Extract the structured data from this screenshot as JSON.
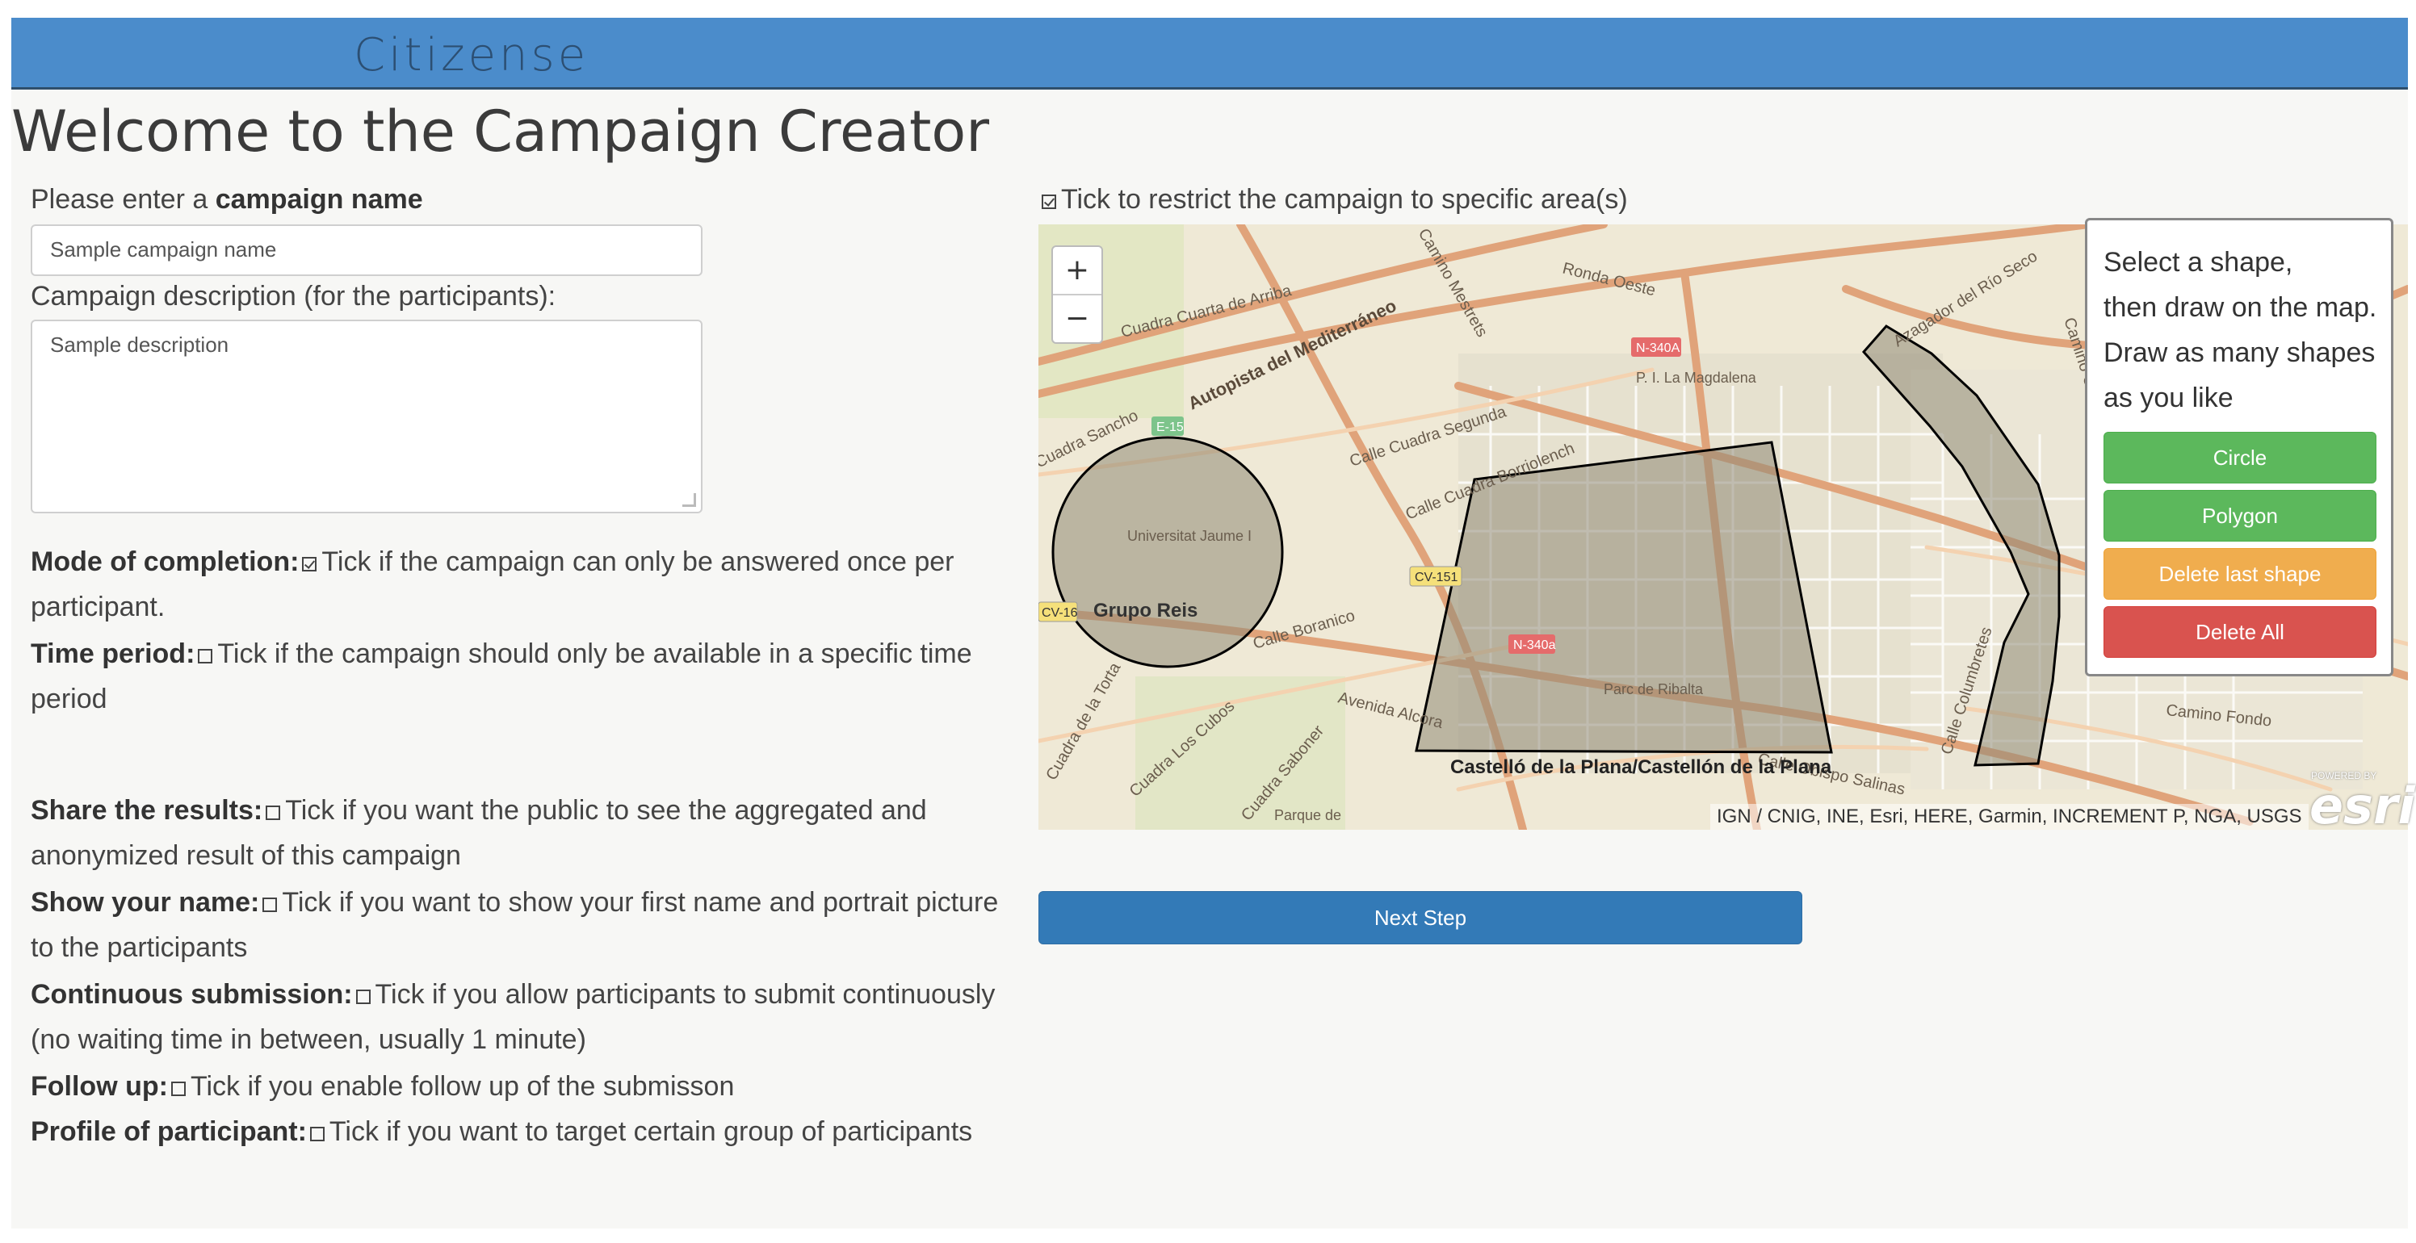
{
  "app": {
    "brand": "Citizense",
    "page_title": "Welcome to the Campaign Creator"
  },
  "form": {
    "name_prefix": "Please enter a ",
    "name_bold": "campaign name",
    "name_value": "Sample campaign name",
    "description_label": "Campaign description (for the participants):",
    "description_value": "Sample description"
  },
  "options": [
    {
      "label": "Mode of completion:",
      "checked": true,
      "text": "Tick if the campaign can only be answered once per participant."
    },
    {
      "label": "Time period:",
      "checked": false,
      "text": "Tick if the campaign should only be available in a specific time period"
    },
    {
      "label": "Share the results:",
      "checked": false,
      "text": "Tick if you want the public to see the aggregated and anonymized result of this campaign"
    },
    {
      "label": "Show your name:",
      "checked": false,
      "text": "Tick if you want to show your first name and portrait picture to the participants"
    },
    {
      "label": "Continuous submission:",
      "checked": false,
      "text": "Tick if you allow participants to submit continuously (no waiting time in between, usually 1 minute)"
    },
    {
      "label": "Follow up:",
      "checked": false,
      "text": "Tick if you enable follow up of the submisson"
    },
    {
      "label": "Profile of participant:",
      "checked": false,
      "text": "Tick if you want to target certain group of participants"
    }
  ],
  "map": {
    "restrict_text": "Tick to restrict the campaign to specific area(s)",
    "restrict_checked": true,
    "zoom_in": "+",
    "zoom_out": "−",
    "attribution": "IGN / CNIG, INE, Esri, HERE, Garmin, INCREMENT P, NGA, USGS",
    "esri_powered": "POWERED BY",
    "esri_logo": "esri",
    "labels": {
      "ronda_oeste": "Ronda Oeste",
      "cuadra_cuarta": "Cuadra Cuarta de Arriba",
      "autopista": "Autopista del Mediterráneo",
      "calle_cuadra_segunda": "Calle Cuadra Segunda",
      "calle_cuadra_borriolench": "Calle Cuadra Borriolench",
      "universitat": "Universitat Jaume I",
      "grupo_reis": "Grupo Reis",
      "calle_boranico": "Calle Boranico",
      "avenida_alcora": "Avenida Alcora",
      "castello": "Castelló de la Plana/Castellón de la Plana",
      "calle_obispo": "Calle Obispo Salinas",
      "camino_fondo": "Camino Fondo",
      "calle_columbretes": "Calle Columbretes",
      "azagador": "Azagador del Río Seco",
      "camino_caminas": "Camino Caminas",
      "pi_magdalena": "P. I. La Magdalena",
      "parc_ribalta": "Parc de Ribalta",
      "cuadra_sancho": "Cuadra Sancho",
      "cuadra_torta": "Cuadra de la Torta",
      "cuadra_cubos": "Cuadra Los Cubos",
      "cuadra_saboner": "Cuadra Saboner",
      "parque": "Parque de",
      "mestrets": "Camino Mestrets",
      "n340a": "N-340A",
      "n340a2": "N-340a",
      "cv151": "CV-151",
      "cv16": "CV-16",
      "e15": "E-15"
    }
  },
  "draw_panel": {
    "instructions": [
      "Select a shape,",
      "then draw on the map.",
      "Draw as many shapes",
      "as you like"
    ],
    "circle": "Circle",
    "polygon": "Polygon",
    "delete_last": "Delete last shape",
    "delete_all": "Delete All"
  },
  "next_button": "Next Step"
}
